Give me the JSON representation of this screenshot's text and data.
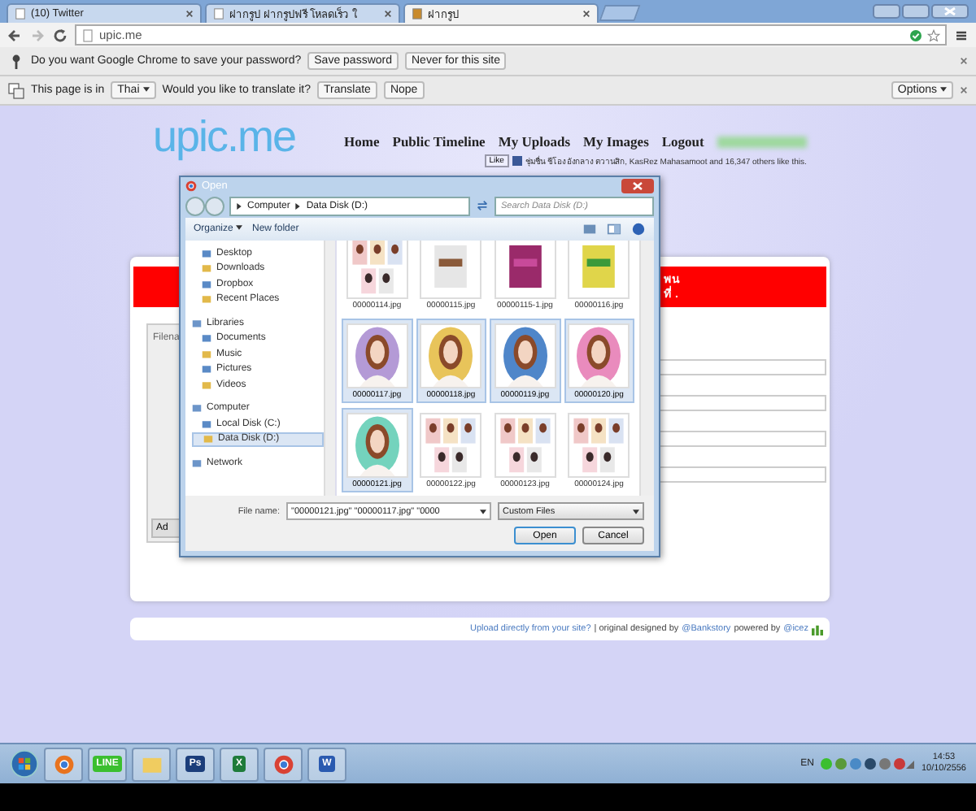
{
  "browser": {
    "tabs": [
      {
        "title": "(10) Twitter",
        "selected": false
      },
      {
        "title": "ฝากรูป ฝากรูปฟรี โหลดเร็ว ใ",
        "selected": false
      },
      {
        "title": "ฝากรูป",
        "selected": true
      }
    ],
    "url": "upic.me"
  },
  "password_bar": {
    "message": "Do you want Google Chrome to save your password?",
    "buttons": [
      "Save password",
      "Never for this site"
    ]
  },
  "translate_bar": {
    "prefix": "This page is in",
    "language": "Thai",
    "question": "Would you like to translate it?",
    "buttons": [
      "Translate",
      "Nope"
    ],
    "options": "Options"
  },
  "site": {
    "logo": "upic.me",
    "nav": [
      "Home",
      "Public Timeline",
      "My Uploads",
      "My Images",
      "Logout"
    ],
    "like_button": "Like",
    "like_text": "ชุ่มชื่น ชีโอง อังกลาง ตวานสิก, KasRez Mahasamoot and 16,347 others like this.",
    "banner": [
      "พน",
      "ที่ ."
    ],
    "uploader_header": "Filena",
    "add_button": "Ad",
    "footer": {
      "link1": "Upload directly from your site?",
      "text1": "| original designed by",
      "link2": "@Bankstory",
      "text2": "powered by",
      "link3": "@icez"
    }
  },
  "dialog": {
    "title": "Open",
    "breadcrumb": [
      "Computer",
      "Data Disk (D:)"
    ],
    "search_placeholder": "Search Data Disk (D:)",
    "organize": "Organize",
    "new_folder": "New folder",
    "nav": [
      {
        "items": [
          {
            "label": "Desktop",
            "selected": false
          },
          {
            "label": "Downloads",
            "selected": false
          },
          {
            "label": "Dropbox",
            "selected": false
          },
          {
            "label": "Recent Places",
            "selected": false
          }
        ]
      },
      {
        "label": "Libraries",
        "items": [
          {
            "label": "Documents",
            "selected": false
          },
          {
            "label": "Music",
            "selected": false
          },
          {
            "label": "Pictures",
            "selected": false
          },
          {
            "label": "Videos",
            "selected": false
          }
        ]
      },
      {
        "label": "Computer",
        "items": [
          {
            "label": "Local Disk (C:)",
            "selected": false
          },
          {
            "label": "Data Disk (D:)",
            "selected": true
          }
        ]
      },
      {
        "label": "Network"
      }
    ],
    "files": [
      {
        "name": "00000114.jpg",
        "selected": false
      },
      {
        "name": "00000115.jpg",
        "selected": false
      },
      {
        "name": "00000115-1.jpg",
        "selected": false
      },
      {
        "name": "00000116.jpg",
        "selected": false
      },
      {
        "name": "00000117.jpg",
        "selected": true
      },
      {
        "name": "00000118.jpg",
        "selected": true
      },
      {
        "name": "00000119.jpg",
        "selected": true
      },
      {
        "name": "00000120.jpg",
        "selected": true
      },
      {
        "name": "00000121.jpg",
        "selected": true
      },
      {
        "name": "00000122.jpg",
        "selected": false
      },
      {
        "name": "00000123.jpg",
        "selected": false
      },
      {
        "name": "00000124.jpg",
        "selected": false
      }
    ],
    "file_name_label": "File name:",
    "file_name_value": "\"00000121.jpg\" \"00000117.jpg\" \"0000",
    "file_type": "Custom Files",
    "buttons": [
      "Open",
      "Cancel"
    ]
  },
  "taskbar": {
    "apps": [
      {
        "kind": "firefox"
      },
      {
        "kind": "line",
        "glyph": "LINE"
      },
      {
        "kind": "explorer"
      },
      {
        "kind": "photoshop",
        "glyph": "Ps"
      },
      {
        "kind": "excel",
        "glyph": "X"
      },
      {
        "kind": "chrome"
      },
      {
        "kind": "word",
        "glyph": "W"
      }
    ],
    "language": "EN",
    "time": "14:53",
    "date": "10/10/2556"
  }
}
